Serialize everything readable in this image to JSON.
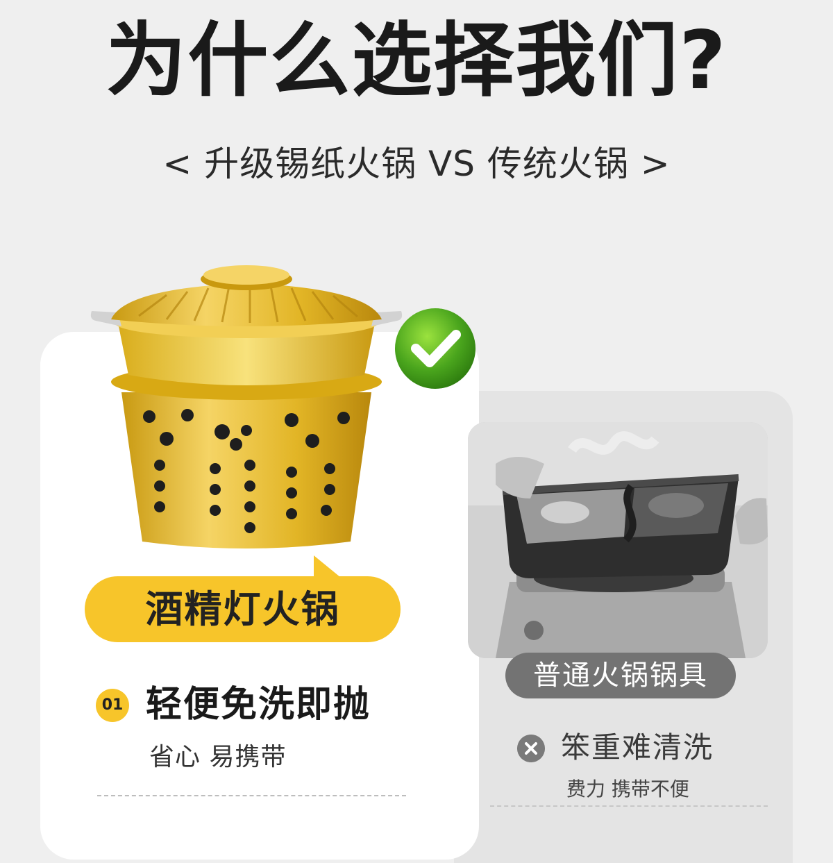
{
  "header": {
    "title": "为什么选择我们?",
    "subtitle": "< 升级锡纸火锅 VS 传统火锅 >"
  },
  "left_product": {
    "label": "酒精灯火锅",
    "feature_number": "01",
    "feature_title": "轻便免洗即抛",
    "feature_subtitle": "省心 易携带",
    "badge_icon": "check-icon",
    "accent_color": "#f7c52a"
  },
  "right_product": {
    "label": "普通火锅锅具",
    "con_icon": "x-circle-icon",
    "con_title": "笨重难清洗",
    "con_subtitle": "费力 携带不便"
  }
}
